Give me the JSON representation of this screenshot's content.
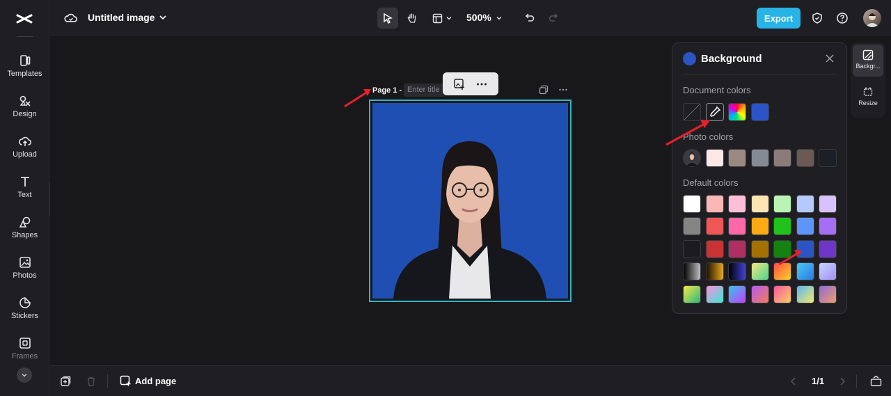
{
  "sidebar": {
    "items": [
      {
        "label": "Templates",
        "icon": "templates-icon"
      },
      {
        "label": "Design",
        "icon": "design-icon"
      },
      {
        "label": "Upload",
        "icon": "upload-icon"
      },
      {
        "label": "Text",
        "icon": "text-icon"
      },
      {
        "label": "Shapes",
        "icon": "shapes-icon"
      },
      {
        "label": "Photos",
        "icon": "photos-icon"
      },
      {
        "label": "Stickers",
        "icon": "stickers-icon"
      },
      {
        "label": "Frames",
        "icon": "frames-icon"
      }
    ]
  },
  "topbar": {
    "title": "Untitled image",
    "zoom": "500%",
    "export_label": "Export"
  },
  "canvas": {
    "page_label": "Page 1 -",
    "page_title_placeholder": "Enter title"
  },
  "bottombar": {
    "add_page_label": "Add page",
    "page_count": "1/1"
  },
  "background_panel": {
    "title": "Background",
    "current_color": "#2b55c6",
    "sections": {
      "document": "Document colors",
      "photo": "Photo colors",
      "default": "Default colors"
    },
    "document_colors": [
      "none",
      "eyedropper",
      "rainbow",
      "#2b55c6"
    ],
    "photo_colors": [
      "photo-thumb",
      "#fde7e7",
      "#9b8880",
      "#868a94",
      "#8d7b7b",
      "#6c5954",
      "#1c1f25"
    ],
    "default_colors": [
      [
        "#ffffff",
        "#fbb6b6",
        "#fdbfd6",
        "#fde4b2",
        "#b9f4b4",
        "#b4c9fd",
        "#d8c2fb"
      ],
      [
        "#858585",
        "#ef5656",
        "#fe67a8",
        "#fbaa16",
        "#22c21c",
        "#5e95fa",
        "#a56ef5"
      ],
      [
        "#1c1c20",
        "#c93333",
        "#b02f62",
        "#a37100",
        "#15820f",
        "#2b55c6",
        "#6d36c6"
      ],
      [
        "linear-gradient(90deg,#000,#bdbdbd)",
        "linear-gradient(90deg,#1d1300,#e6a71a)",
        "linear-gradient(90deg,#000,#4341d9)",
        "linear-gradient(135deg,#f4e783,#49d58a)",
        "linear-gradient(135deg,#ff4c4c,#f9d423)",
        "linear-gradient(135deg,#49c9f7,#2c79e0)",
        "linear-gradient(135deg,#c6d6fd,#a28df5)"
      ],
      [
        "linear-gradient(135deg,#f7e94b,#25b87a)",
        "linear-gradient(135deg,#f98fe0,#3ee7d1)",
        "linear-gradient(135deg,#34c4f5,#c63ff5)",
        "linear-gradient(135deg,#b55cf2,#f37b59)",
        "linear-gradient(135deg,#f7569e,#fbd067)",
        "linear-gradient(135deg,#5ab6f5,#f5ea6a)",
        "linear-gradient(135deg,#8e6bd8,#f09d6b)"
      ]
    ]
  },
  "right_rail": {
    "items": [
      {
        "label": "Backgr...",
        "icon": "background-icon"
      },
      {
        "label": "Resize",
        "icon": "resize-icon"
      }
    ]
  }
}
